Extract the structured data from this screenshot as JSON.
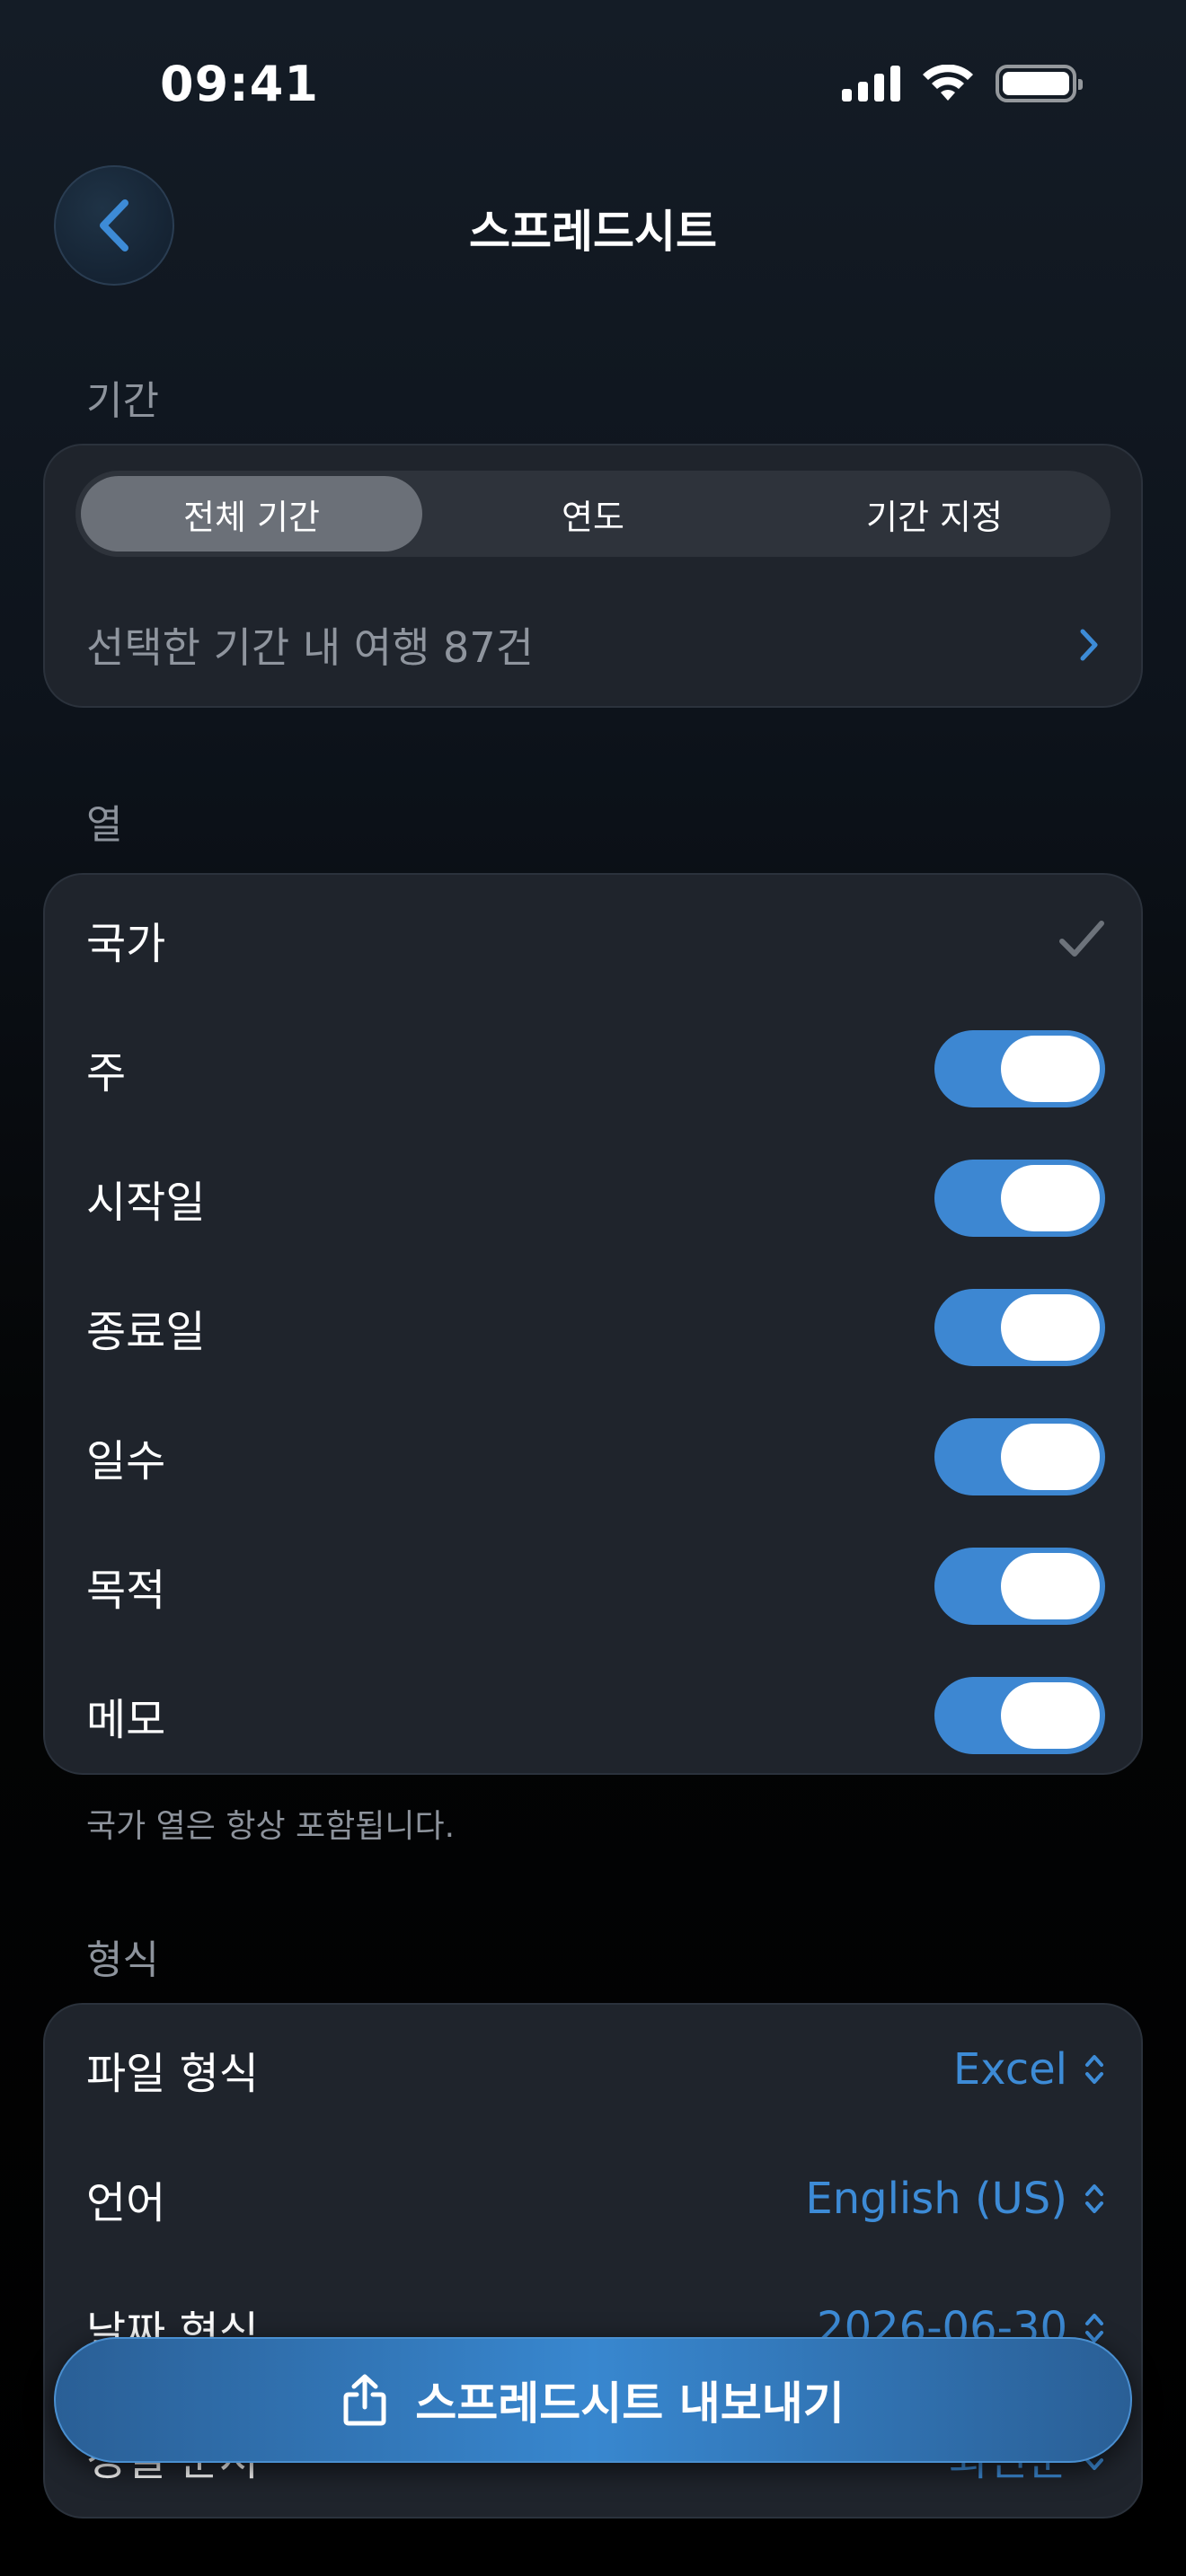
{
  "status_bar": {
    "time": "09:41"
  },
  "nav": {
    "title": "스프레드시트"
  },
  "period": {
    "section_label": "기간",
    "segments": [
      "전체 기간",
      "연도",
      "기간 지정"
    ],
    "selected_segment": "전체 기간",
    "trip_count_text": "선택한 기간 내 여행 87건"
  },
  "columns": {
    "section_label": "열",
    "items": [
      {
        "label": "국가",
        "control": "checkmark",
        "checked": true
      },
      {
        "label": "주",
        "control": "toggle",
        "on": true
      },
      {
        "label": "시작일",
        "control": "toggle",
        "on": true
      },
      {
        "label": "종료일",
        "control": "toggle",
        "on": true
      },
      {
        "label": "일수",
        "control": "toggle",
        "on": true
      },
      {
        "label": "목적",
        "control": "toggle",
        "on": true
      },
      {
        "label": "메모",
        "control": "toggle",
        "on": true
      }
    ],
    "footnote": "국가 열은 항상 포함됩니다."
  },
  "format": {
    "section_label": "형식",
    "rows": [
      {
        "label": "파일 형식",
        "value": "Excel"
      },
      {
        "label": "언어",
        "value": "English (US)"
      },
      {
        "label": "날짜 형식",
        "value": "2026-06-30"
      },
      {
        "label": "정렬 순서",
        "value": "최신순"
      }
    ]
  },
  "export_button": {
    "label": "스프레드시트 내보내기"
  },
  "colors": {
    "accent": "#3d87d2",
    "card": "#1f242c",
    "secondary_text": "#8d939c"
  }
}
